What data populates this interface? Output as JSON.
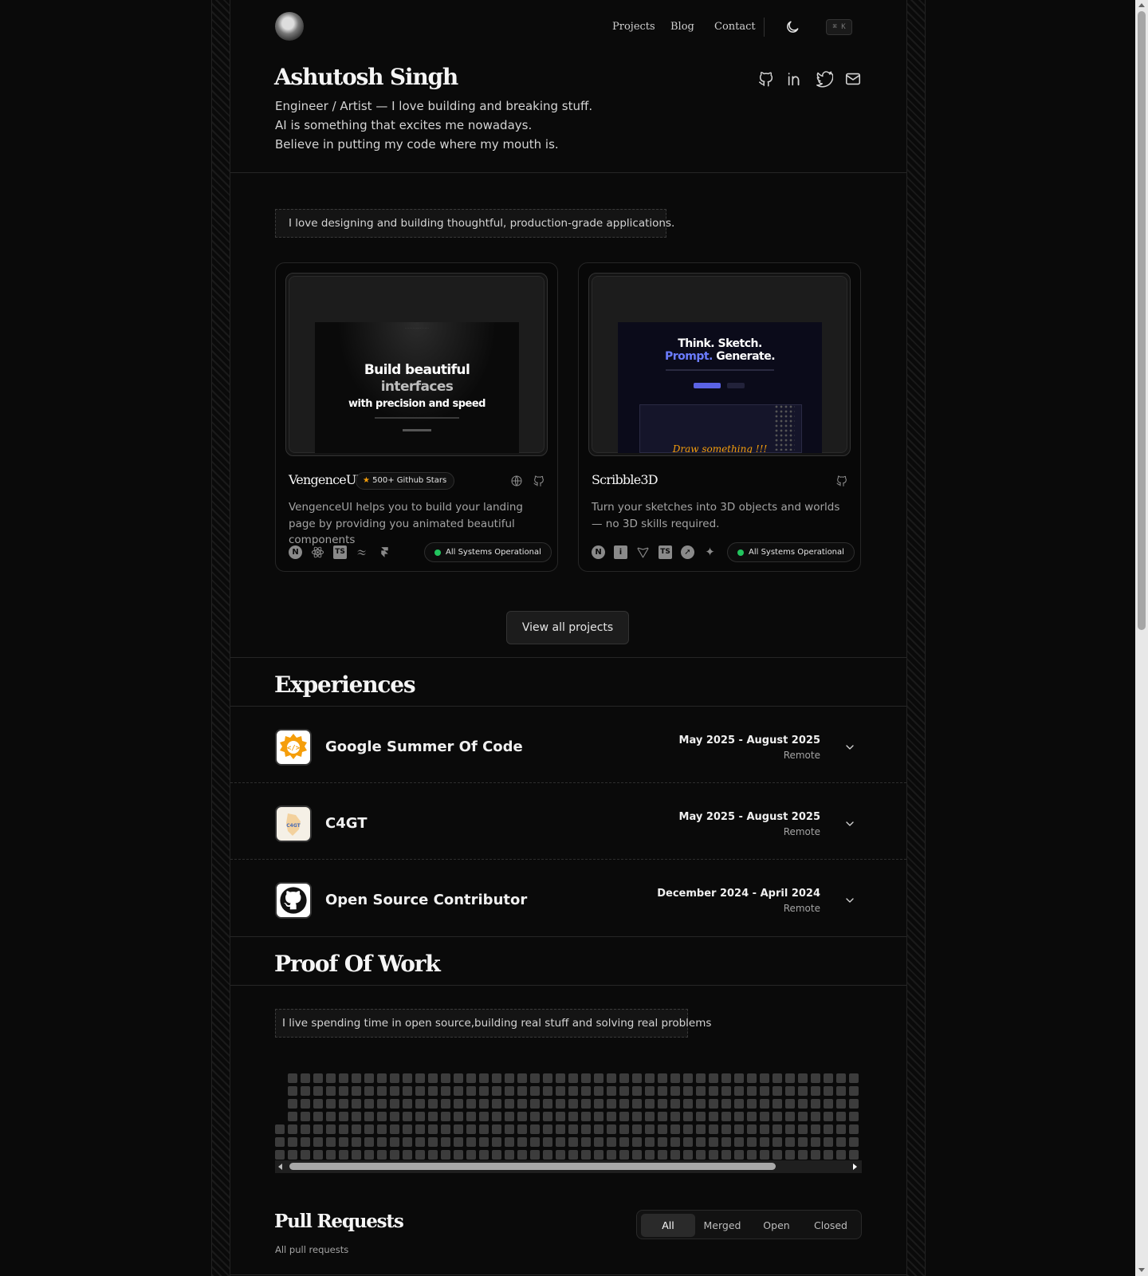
{
  "nav": {
    "links": [
      "Projects",
      "Blog",
      "Contact"
    ],
    "kbd": "⌘ K"
  },
  "profile": {
    "name": "Ashutosh Singh",
    "bio": [
      "Engineer / Artist — I love building and breaking stuff.",
      "AI is something that excites me nowadays.",
      "Believe in putting my code where my mouth is."
    ],
    "socials": [
      "github-icon",
      "linkedin-icon",
      "twitter-icon",
      "mail-icon"
    ]
  },
  "projects": {
    "tagline": "I love designing and building thoughtful, production-grade applications.",
    "items": [
      {
        "title": "VengenceUI",
        "stars_badge": "500+ Github Stars",
        "description": "VengenceUI helps you to build your landing page by providing you animated beautiful components",
        "status": "All Systems Operational",
        "preview": {
          "line1": "Build beautiful",
          "line2": "interfaces",
          "line3": "with precision and speed"
        },
        "tech": [
          "nextjs-icon",
          "react-icon",
          "typescript-icon",
          "tailwind-icon",
          "framer-icon"
        ]
      },
      {
        "title": "Scribble3D",
        "description": "Turn your sketches into 3D objects and worlds — no 3D skills required.",
        "status": "All Systems Operational",
        "preview": {
          "line1": "Think. Sketch.",
          "line2a": "Prompt.",
          "line2b": " Generate.",
          "line3": "Draw something !!!"
        },
        "tech": [
          "nextjs-icon",
          "info-icon",
          "vite-icon",
          "typescript-icon",
          "compass-icon",
          "sparkle-icon"
        ]
      }
    ],
    "view_all": "View all projects"
  },
  "experiences": {
    "title": "Experiences",
    "items": [
      {
        "name": "Google Summer Of Code",
        "date": "May 2025 - August 2025",
        "location": "Remote"
      },
      {
        "name": "C4GT",
        "date": "May 2025 - August 2025",
        "location": "Remote"
      },
      {
        "name": "Open Source Contributor",
        "date": "December 2024 - April 2024",
        "location": "Remote"
      }
    ]
  },
  "proof": {
    "title": "Proof Of Work",
    "tagline": "I live spending time in open source,building real stuff and solving real problems"
  },
  "pull_requests": {
    "title": "Pull Requests",
    "subtitle": "All pull requests",
    "filters": [
      "All",
      "Merged",
      "Open",
      "Closed"
    ],
    "active_filter": "All"
  },
  "colors": {
    "background": "#0a0a0a",
    "status_green": "#22c55e",
    "accent_blue": "#6b7cff",
    "gsoc_orange": "#f59e0b"
  }
}
